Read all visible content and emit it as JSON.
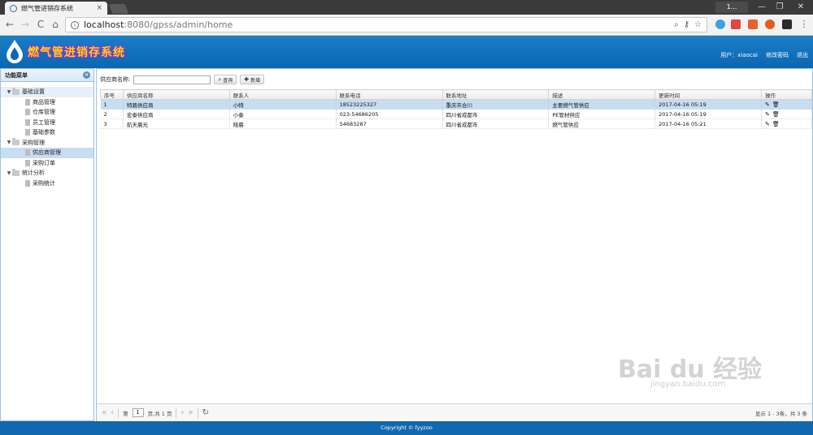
{
  "browser": {
    "tab_title": "燃气管进销存系统",
    "tab_close": "×",
    "profile_label": "1...",
    "url_host": "localhost",
    "url_path": ":8080/gpss/admin/home",
    "nav_back": "←",
    "nav_forward": "→",
    "nav_reload": "C",
    "nav_home": "⌂",
    "win_min": "—",
    "win_max": "❐",
    "win_close": "✕"
  },
  "header": {
    "app_title": "燃气管进销存系统",
    "user_label": "用户：xiaocai",
    "change_pwd": "修改密码",
    "logout": "退出"
  },
  "sidebar": {
    "title": "功能菜单",
    "collapse_glyph": "«",
    "groups": [
      {
        "label": "基础设置",
        "items": [
          "商品管理",
          "仓库管理",
          "员工管理",
          "基础参数"
        ]
      },
      {
        "label": "采购管理",
        "items": [
          "供应商管理",
          "采购订单"
        ]
      },
      {
        "label": "统计分析",
        "items": [
          "采购统计"
        ]
      }
    ]
  },
  "search": {
    "label": "供应商名称:",
    "value": "",
    "query_button": "查询",
    "add_button": "新增"
  },
  "table": {
    "columns": [
      "序号",
      "供应商名称",
      "联系人",
      "联系电话",
      "联系地址",
      "描述",
      "更新时间",
      "操作"
    ],
    "rows": [
      [
        "1",
        "特路供应商",
        "小特",
        "18523225327",
        "重庆市合川",
        "主要燃气管供应",
        "2017-04-16 05:19"
      ],
      [
        "2",
        "宏泰供应商",
        "小泰",
        "023-54686205",
        "四川省成都市",
        "PE管材供应",
        "2017-04-16 05:19"
      ],
      [
        "3",
        "航天晨光",
        "晓晨",
        "54683287",
        "四川省成都市",
        "燃气管供应",
        "2017-04-16 05:21"
      ]
    ]
  },
  "pager": {
    "page_prefix": "第",
    "page_value": "1",
    "page_suffix": "页,共 1 页",
    "info": "显示 1 - 3条，共 3 条"
  },
  "footer": {
    "copyright": "Copyright © fyyzoo"
  },
  "watermark": {
    "text": "Bai du 经验",
    "sub": "jingyan.baidu.com"
  },
  "colors": {
    "header_bg": "#0c66b0",
    "selected_row": "#c6ddf2",
    "logo_text": "#ffd400"
  }
}
